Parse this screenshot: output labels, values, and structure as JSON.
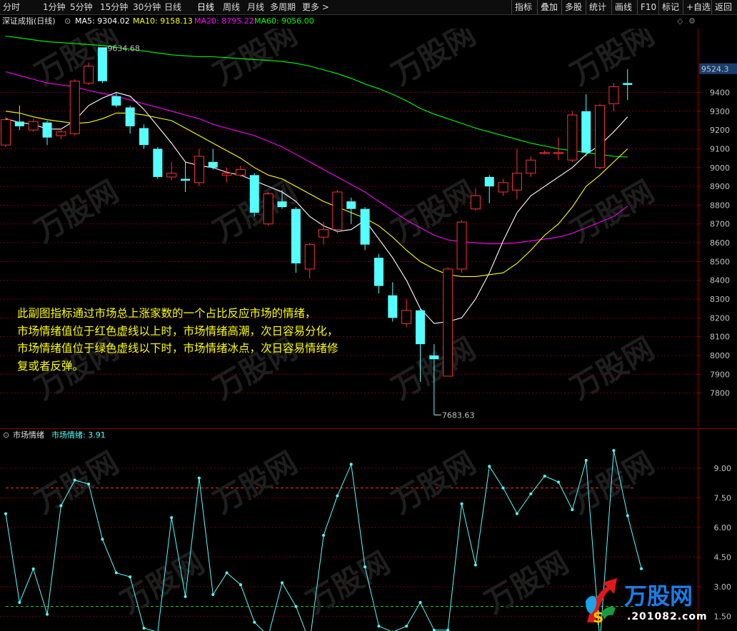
{
  "toolbar": {
    "periods": [
      "分时",
      "1分钟",
      "5分钟",
      "15分钟",
      "30分钟",
      "日线",
      "周线",
      "月线",
      "多周期",
      "更多 >"
    ],
    "active_period": "日线",
    "right_buttons": [
      "指标",
      "叠加",
      "多股",
      "统计",
      "画线",
      "F10",
      "标记",
      "+自选",
      "返回"
    ]
  },
  "header": {
    "title": "深证成指(日线)",
    "ma5": "MA5: 9304.02",
    "ma10": "MA10: 9158.13",
    "ma20": "MA20: 8795.22",
    "ma60": "MA60: 9056.00",
    "colors": {
      "ma5": "#ffffff",
      "ma10": "#ffff00",
      "ma20": "#ff00ff",
      "ma60": "#00ff00",
      "up": "#ff3232",
      "down": "#54ffff",
      "annotation": "#ffff00"
    }
  },
  "price_axis": {
    "current_price": "9524.3",
    "ticks": [
      "9400",
      "9300",
      "9200",
      "9100",
      "9000",
      "8900",
      "8800",
      "8700",
      "8600",
      "8500",
      "8400",
      "8300",
      "8200",
      "8100",
      "8000",
      "7900",
      "7800"
    ]
  },
  "annotations": {
    "high_label": "9634.68",
    "low_label": "7683.63",
    "note_lines": [
      "此副图指标通过市场总上涨家数的一个占比反应市场的情绪，",
      "市场情绪值位于红色虚线以上时，市场情绪高潮，次日容易分化，",
      "市场情绪值位于绿色虚线以下时，市场情绪冰点，次日容易情绪修",
      "复或者反弹。"
    ]
  },
  "indicator": {
    "name": "市场情绪",
    "value_label": "市场情绪: 3.91",
    "ticks": [
      "9.00",
      "7.50",
      "6.00",
      "4.50",
      "3.00",
      "1.50"
    ]
  },
  "watermark": {
    "brand": "万股网",
    "domain": ".201082.com"
  },
  "chart_data": [
    {
      "type": "candlestick",
      "title": "深证成指(日线)",
      "ylim": [
        7620,
        9740
      ],
      "candles": [
        {
          "o": 9120,
          "c": 9255,
          "h": 9270,
          "l": 9110
        },
        {
          "o": 9245,
          "c": 9220,
          "h": 9330,
          "l": 9200
        },
        {
          "o": 9200,
          "c": 9245,
          "h": 9260,
          "l": 9190
        },
        {
          "o": 9240,
          "c": 9160,
          "h": 9250,
          "l": 9120
        },
        {
          "o": 9170,
          "c": 9190,
          "h": 9210,
          "l": 9150
        },
        {
          "o": 9180,
          "c": 9460,
          "h": 9470,
          "l": 9170
        },
        {
          "o": 9450,
          "c": 9540,
          "h": 9560,
          "l": 9440
        },
        {
          "o": 9640,
          "c": 9460,
          "h": 9634.68,
          "l": 9450
        },
        {
          "o": 9380,
          "c": 9330,
          "h": 9400,
          "l": 9320
        },
        {
          "o": 9320,
          "c": 9220,
          "h": 9330,
          "l": 9180
        },
        {
          "o": 9210,
          "c": 9120,
          "h": 9230,
          "l": 9100
        },
        {
          "o": 9100,
          "c": 8950,
          "h": 9110,
          "l": 8940
        },
        {
          "o": 8950,
          "c": 8970,
          "h": 9030,
          "l": 8930
        },
        {
          "o": 8940,
          "c": 8930,
          "h": 9030,
          "l": 8870
        },
        {
          "o": 8920,
          "c": 9060,
          "h": 9100,
          "l": 8900
        },
        {
          "o": 9030,
          "c": 9000,
          "h": 9100,
          "l": 8990
        },
        {
          "o": 8960,
          "c": 8970,
          "h": 9000,
          "l": 8920
        },
        {
          "o": 8960,
          "c": 8990,
          "h": 9010,
          "l": 8950
        },
        {
          "o": 8960,
          "c": 8760,
          "h": 8970,
          "l": 8740
        },
        {
          "o": 8700,
          "c": 8860,
          "h": 8870,
          "l": 8690
        },
        {
          "o": 8820,
          "c": 8790,
          "h": 8880,
          "l": 8780
        },
        {
          "o": 8780,
          "c": 8490,
          "h": 8790,
          "l": 8440
        },
        {
          "o": 8460,
          "c": 8590,
          "h": 8600,
          "l": 8410
        },
        {
          "o": 8630,
          "c": 8670,
          "h": 8710,
          "l": 8590
        },
        {
          "o": 8670,
          "c": 8870,
          "h": 8880,
          "l": 8650
        },
        {
          "o": 8820,
          "c": 8780,
          "h": 8840,
          "l": 8700
        },
        {
          "o": 8780,
          "c": 8590,
          "h": 8790,
          "l": 8560
        },
        {
          "o": 8520,
          "c": 8370,
          "h": 8540,
          "l": 8330
        },
        {
          "o": 8320,
          "c": 8200,
          "h": 8390,
          "l": 8180
        },
        {
          "o": 8170,
          "c": 8240,
          "h": 8300,
          "l": 8150
        },
        {
          "o": 8240,
          "c": 8060,
          "h": 8250,
          "l": 7860
        },
        {
          "o": 8000,
          "c": 7980,
          "h": 8060,
          "l": 7683.63
        },
        {
          "o": 7890,
          "c": 8460,
          "h": 8470,
          "l": 7890
        },
        {
          "o": 8460,
          "c": 8710,
          "h": 8720,
          "l": 8440
        },
        {
          "o": 8780,
          "c": 8850,
          "h": 8890,
          "l": 8770
        },
        {
          "o": 8950,
          "c": 8900,
          "h": 8960,
          "l": 8810
        },
        {
          "o": 8870,
          "c": 8920,
          "h": 8940,
          "l": 8850
        },
        {
          "o": 8880,
          "c": 8970,
          "h": 9100,
          "l": 8830
        },
        {
          "o": 8970,
          "c": 9040,
          "h": 9060,
          "l": 8950
        },
        {
          "o": 9080,
          "c": 9080,
          "h": 9090,
          "l": 9070
        },
        {
          "o": 9080,
          "c": 9080,
          "h": 9160,
          "l": 9040
        },
        {
          "o": 9040,
          "c": 9280,
          "h": 9300,
          "l": 9030
        },
        {
          "o": 9300,
          "c": 9080,
          "h": 9390,
          "l": 9060
        },
        {
          "o": 9000,
          "c": 9330,
          "h": 9340,
          "l": 8990
        },
        {
          "o": 9340,
          "c": 9430,
          "h": 9450,
          "l": 9300
        },
        {
          "o": 9450,
          "c": 9440,
          "h": 9524.3,
          "l": 9360
        }
      ],
      "ma5": [
        9260,
        9240,
        9230,
        9205,
        9205,
        9250,
        9330,
        9370,
        9400,
        9380,
        9310,
        9220,
        9130,
        9030,
        9010,
        9000,
        8975,
        8960,
        8930,
        8900,
        8870,
        8820,
        8740,
        8690,
        8660,
        8670,
        8720,
        8620,
        8520,
        8400,
        8250,
        8170,
        8180,
        8200,
        8300,
        8440,
        8610,
        8760,
        8850,
        8900,
        8950,
        9000,
        9070,
        9120,
        9190,
        9270
      ],
      "ma10": [
        9300,
        9290,
        9270,
        9255,
        9245,
        9235,
        9240,
        9260,
        9290,
        9290,
        9280,
        9265,
        9250,
        9210,
        9170,
        9130,
        9090,
        9050,
        9000,
        8960,
        8940,
        8900,
        8860,
        8820,
        8790,
        8760,
        8730,
        8690,
        8630,
        8560,
        8500,
        8460,
        8430,
        8420,
        8420,
        8430,
        8440,
        8490,
        8560,
        8640,
        8700,
        8790,
        8900,
        8960,
        9030,
        9100
      ],
      "ma20": [
        9510,
        9490,
        9470,
        9450,
        9440,
        9430,
        9410,
        9395,
        9380,
        9360,
        9340,
        9320,
        9300,
        9280,
        9260,
        9230,
        9210,
        9190,
        9170,
        9140,
        9110,
        9070,
        9030,
        8990,
        8950,
        8910,
        8870,
        8820,
        8770,
        8720,
        8680,
        8640,
        8615,
        8605,
        8600,
        8595,
        8595,
        8600,
        8610,
        8620,
        8630,
        8650,
        8680,
        8710,
        8740,
        8795
      ],
      "ma60": [
        9700,
        9690,
        9680,
        9670,
        9665,
        9660,
        9655,
        9650,
        9640,
        9630,
        9620,
        9610,
        9600,
        9595,
        9590,
        9590,
        9585,
        9580,
        9575,
        9570,
        9565,
        9555,
        9540,
        9520,
        9500,
        9475,
        9445,
        9420,
        9390,
        9355,
        9315,
        9285,
        9260,
        9235,
        9210,
        9190,
        9170,
        9150,
        9130,
        9115,
        9100,
        9090,
        9080,
        9070,
        9060,
        9056
      ]
    },
    {
      "type": "line",
      "title": "市场情绪",
      "ylim": [
        0.9,
        10.3
      ],
      "values": [
        6.7,
        2.2,
        3.9,
        1.6,
        7.1,
        8.4,
        8.2,
        5.4,
        3.7,
        3.5,
        0.9,
        0.7,
        6.5,
        2.5,
        8.5,
        2.6,
        3.7,
        3.1,
        1.2,
        0.5,
        3.2,
        2.0,
        0.2,
        5.6,
        7.6,
        9.2,
        4.0,
        1.0,
        0.7,
        1.0,
        2.2,
        0.8,
        0.8,
        7.2,
        4.1,
        9.1,
        8.0,
        6.7,
        7.7,
        8.6,
        8.3,
        6.9,
        9.4,
        0.2,
        9.9,
        6.6,
        3.91
      ],
      "upper_threshold": 8.0,
      "lower_threshold": 2.0
    }
  ]
}
